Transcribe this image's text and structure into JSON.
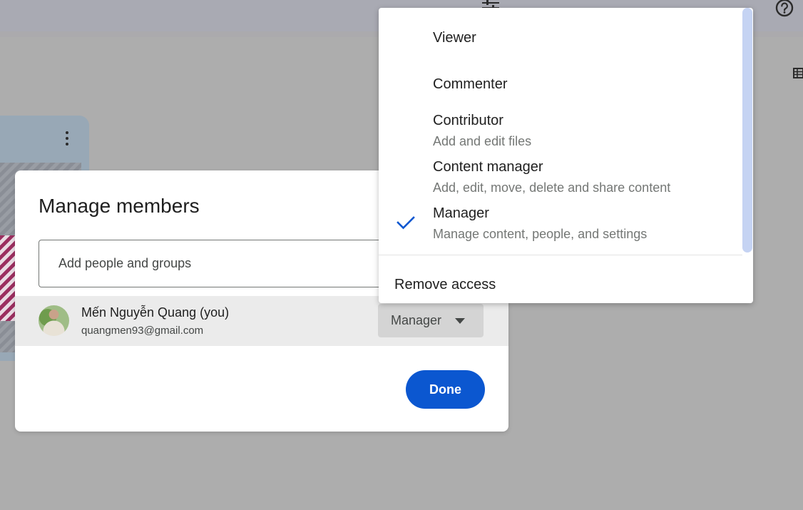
{
  "background": {
    "toolbar_icons": [
      "tune-icon",
      "help-icon",
      "grid-view-icon"
    ],
    "card_icons": [
      "more-vert-icon"
    ]
  },
  "dialog": {
    "title": "Manage members",
    "add_people": {
      "placeholder": "Add people and groups",
      "value": ""
    },
    "member": {
      "name": "Mến Nguyễn Quang (you)",
      "email": "quangmen93@gmail.com",
      "role": "Manager",
      "avatar_icon": "avatar-photo"
    },
    "done_label": "Done",
    "colors": {
      "primary": "#0b57d0",
      "row_highlight": "#ebebeb",
      "role_chip": "#d4d4d4"
    }
  },
  "role_menu": {
    "items": [
      {
        "title": "Viewer",
        "description": "",
        "selected": false
      },
      {
        "title": "Commenter",
        "description": "",
        "selected": false
      },
      {
        "title": "Contributor",
        "description": "Add and edit files",
        "selected": false
      },
      {
        "title": "Content manager",
        "description": "Add, edit, move, delete and share content",
        "selected": false
      },
      {
        "title": "Manager",
        "description": "Manage content, people, and settings",
        "selected": true
      }
    ],
    "remove_label": "Remove access",
    "selected_icon": "check-icon",
    "check_color": "#0b57d0"
  }
}
